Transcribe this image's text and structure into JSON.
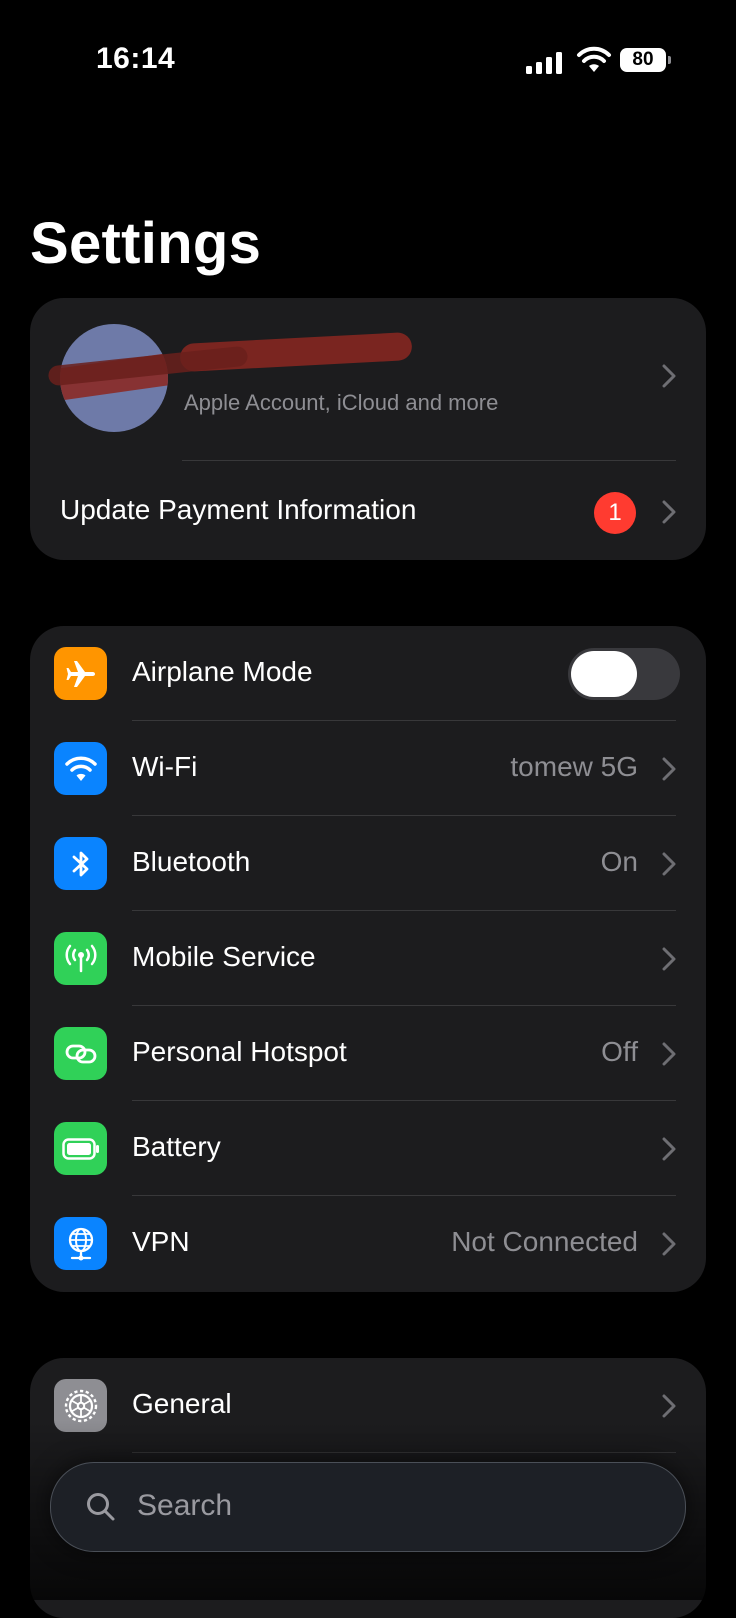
{
  "status_bar": {
    "time": "16:14",
    "battery_level": "80",
    "icons": [
      "cellular-signal-icon",
      "wifi-icon",
      "battery-icon"
    ]
  },
  "title": "Settings",
  "account": {
    "subtitle": "Apple Account, iCloud and more",
    "payment_label": "Update Payment Information",
    "badge_count": "1"
  },
  "connectivity": {
    "rows": [
      {
        "label": "Airplane Mode",
        "icon": "airplane-icon",
        "color": "#ff9500",
        "toggle": false
      },
      {
        "label": "Wi-Fi",
        "value": "tomew 5G",
        "icon": "wifi-icon",
        "color": "#0a84ff"
      },
      {
        "label": "Bluetooth",
        "value": "On",
        "icon": "bluetooth-icon",
        "color": "#0a84ff"
      },
      {
        "label": "Mobile Service",
        "value": "",
        "icon": "antenna-icon",
        "color": "#30d158"
      },
      {
        "label": "Personal Hotspot",
        "value": "Off",
        "icon": "hotspot-link-icon",
        "color": "#30d158"
      },
      {
        "label": "Battery",
        "value": "",
        "icon": "battery-icon",
        "color": "#30d158"
      },
      {
        "label": "VPN",
        "value": "Not Connected",
        "icon": "globe-network-icon",
        "color": "#0a84ff"
      }
    ]
  },
  "general": {
    "rows": [
      {
        "label": "General",
        "icon": "gear-icon",
        "color": "#8e8e93"
      }
    ]
  },
  "search": {
    "placeholder": "Search"
  }
}
